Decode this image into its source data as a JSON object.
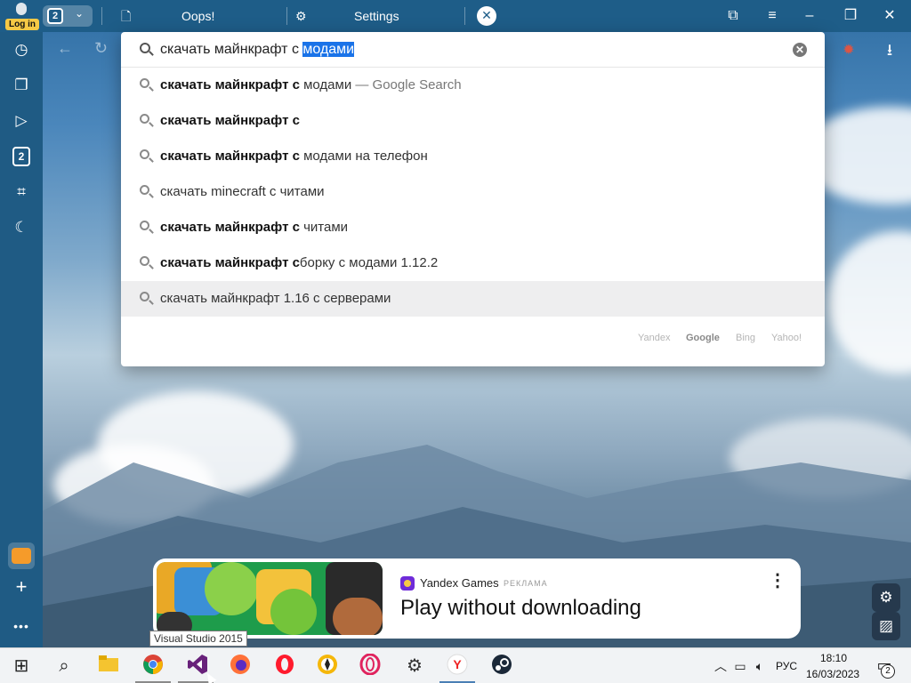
{
  "topbar": {
    "login_label": "Log in",
    "tabs_count": "2",
    "tabs": [
      {
        "label": "Oops!"
      },
      {
        "label": "Settings"
      }
    ]
  },
  "sidebar": {
    "items": [
      {
        "icon": "history-icon"
      },
      {
        "icon": "collections-icon"
      },
      {
        "icon": "play-icon"
      },
      {
        "icon": "tabs-counter-icon",
        "label": "2"
      },
      {
        "icon": "screenshot-icon"
      },
      {
        "icon": "night-mode-icon"
      }
    ],
    "bottom": [
      {
        "icon": "mail-icon"
      },
      {
        "icon": "add-icon"
      },
      {
        "icon": "more-icon"
      }
    ]
  },
  "omnibox": {
    "query_prefix": "скачать майнкрафт с ",
    "query_selected": "модами",
    "suggestions": [
      {
        "bold": "скачать майнкрафт с",
        "rest": " модами",
        "tail": " — Google Search"
      },
      {
        "bold": "скачать майнкрафт с",
        "rest": "",
        "tail": ""
      },
      {
        "bold": "скачать майнкрафт с",
        "rest": " модами на телефон",
        "tail": ""
      },
      {
        "bold": "",
        "rest": "скачать minecraft с читами",
        "tail": ""
      },
      {
        "bold": "скачать майнкрафт с",
        "rest": " читами",
        "tail": ""
      },
      {
        "bold": "скачать майнкрафт с",
        "rest": "борку с модами 1.12.2",
        "tail": ""
      },
      {
        "bold": "",
        "rest": "скачать майнкрафт 1.16 с серверами",
        "tail": ""
      }
    ],
    "engines": [
      "Yandex",
      "Google",
      "Bing",
      "Yahoo!"
    ],
    "active_engine": "Google"
  },
  "ad": {
    "brand": "Yandex Games",
    "tag": "РЕКЛАМА",
    "headline": "Play without downloading"
  },
  "tooltip": "Visual Studio 2015",
  "taskbar": {
    "apps": [
      "windows-start",
      "search",
      "file-explorer",
      "chrome",
      "visual-studio",
      "firefox",
      "opera",
      "browser-yellow",
      "opera-gx",
      "settings",
      "yandex-browser",
      "steam"
    ],
    "lang": "РУС",
    "time": "18:10",
    "date": "16/03/2023",
    "notifications": "2"
  },
  "colors": {
    "topbar": "#1e5d88",
    "selection": "#1a73e8",
    "highlight_row": "#eeeeef"
  }
}
